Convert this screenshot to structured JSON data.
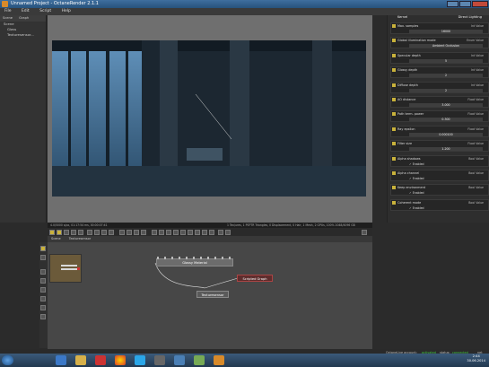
{
  "window": {
    "title": "Unnamed Project - OctaneRender 2.1.1"
  },
  "menu": [
    "File",
    "Edit",
    "Script",
    "Help"
  ],
  "left_panel": {
    "tabs": [
      "Scene",
      "Graph"
    ],
    "tree": [
      "Scene",
      "Glass",
      "Texturesensor..."
    ]
  },
  "viewport": {
    "status_left": "4.0/5000 s/px, 01:17:54 ms, 00:00:07:41",
    "status_right": "1 Tex/ures, 1 PSPTR Triangles, 0 Displacement, 0 Hair, 1 Mesh, 2 GPUs, 100% 2048/4096 GB"
  },
  "node_editor": {
    "tabs": [
      "Scene",
      "Texturesensor"
    ],
    "nodes": {
      "glossy": "Glossy Material",
      "scripted": "Scripted Graph",
      "tex": "Texturesensor"
    }
  },
  "right_panel": {
    "header_title": "Kernel",
    "header_mode": "Direct Lighting",
    "rows": [
      {
        "label": "Max. samples",
        "mode": "Int Value",
        "value": "16000",
        "kind": "value"
      },
      {
        "label": "Global illumination mode",
        "mode": "Enum Value",
        "value": "Ambient Occlusion",
        "kind": "value"
      },
      {
        "label": "Specular depth",
        "mode": "Int Value",
        "value": "5",
        "kind": "value"
      },
      {
        "label": "Glossy depth",
        "mode": "Int Value",
        "value": "2",
        "kind": "value"
      },
      {
        "label": "Diffuse depth",
        "mode": "Int Value",
        "value": "2",
        "kind": "value"
      },
      {
        "label": "AO distance",
        "mode": "Float Value",
        "value": "3.000",
        "kind": "value"
      },
      {
        "label": "Path term. power",
        "mode": "Float Value",
        "value": "0.300",
        "kind": "value"
      },
      {
        "label": "Ray epsilon",
        "mode": "Float Value",
        "value": "0.000100",
        "kind": "value"
      },
      {
        "label": "Filter size",
        "mode": "Float Value",
        "value": "1.200",
        "kind": "value"
      },
      {
        "label": "Alpha shadows",
        "mode": "Bool Value",
        "value": "Enabled",
        "kind": "bool"
      },
      {
        "label": "Alpha channel",
        "mode": "Bool Value",
        "value": "Enabled",
        "kind": "bool"
      },
      {
        "label": "Keep environment",
        "mode": "Bool Value",
        "value": "Enabled",
        "kind": "bool"
      },
      {
        "label": "Coherent mode",
        "mode": "Bool Value",
        "value": "Enabled",
        "kind": "bool"
      }
    ]
  },
  "status_bar": {
    "account_label": "OctaneLive account:",
    "account_state": "activated",
    "status_label": "status:",
    "status_state": "connected",
    "net_label": "net"
  },
  "taskbar": {
    "time": "2:44",
    "date": "30.06.2014"
  },
  "colors": {
    "accent_green": "#3ec33e",
    "pin_yellow": "#c9b23b",
    "scripted_node": "#b04444"
  }
}
